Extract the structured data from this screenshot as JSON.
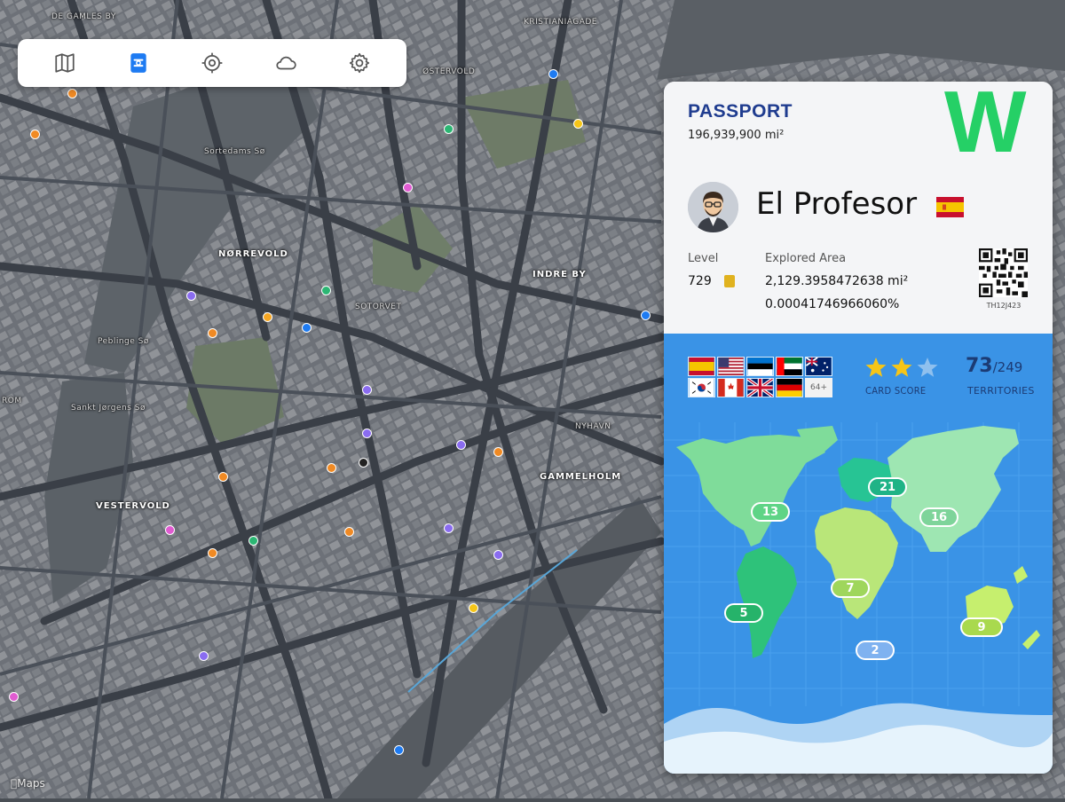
{
  "map": {
    "credit": "Maps",
    "labels": {
      "north_top": "DE GAMLES BY",
      "norrevold": "NØRREVOLD",
      "indre_by": "INDRE BY",
      "vestervold": "VESTERVOLD",
      "gammelholm": "GAMMELHOLM",
      "sortedams": "Sortedams Sø",
      "peblinge": "Peblinge Sø",
      "sankt_jorgens": "Sankt Jørgens Sø",
      "rom": "ROM",
      "ostervold": "ØSTERVOLD",
      "sotorvet": "SOTORVET",
      "nyhavn": "NYHAVN",
      "kristianiagade": "KRISTIANIAGADE"
    }
  },
  "toolbar": {
    "buttons": [
      {
        "name": "map-icon"
      },
      {
        "name": "passport-icon"
      },
      {
        "name": "locate-icon"
      },
      {
        "name": "cloud-icon"
      },
      {
        "name": "gear-icon"
      }
    ],
    "active_color": "#1e7bf2",
    "inactive_color": "#555555"
  },
  "passport": {
    "title": "PASSPORT",
    "area_total": "196,939,900 mi²",
    "logo": "W",
    "username": "El Profesor",
    "level_label": "Level",
    "level_value": "729",
    "explored_label": "Explored Area",
    "explored_value": "2,129.3958472638 mi²",
    "explored_percent": "0.00041746966060%",
    "qr_code_id": "TH12J423",
    "flags_more": "64+",
    "card_score_label": "CARD SCORE",
    "card_score_stars": 2,
    "card_score_max": 3,
    "territories_count": "73",
    "territories_total": "/249",
    "territories_label": "TERRITORIES",
    "regions": {
      "north_america": "13",
      "south_america": "5",
      "europe": "21",
      "africa": "7",
      "asia": "16",
      "oceania": "9",
      "antarctica": "2"
    },
    "colors": {
      "title": "#1f3c8f",
      "logo": "#25d066",
      "panel_blue": "#3a93e6"
    }
  }
}
